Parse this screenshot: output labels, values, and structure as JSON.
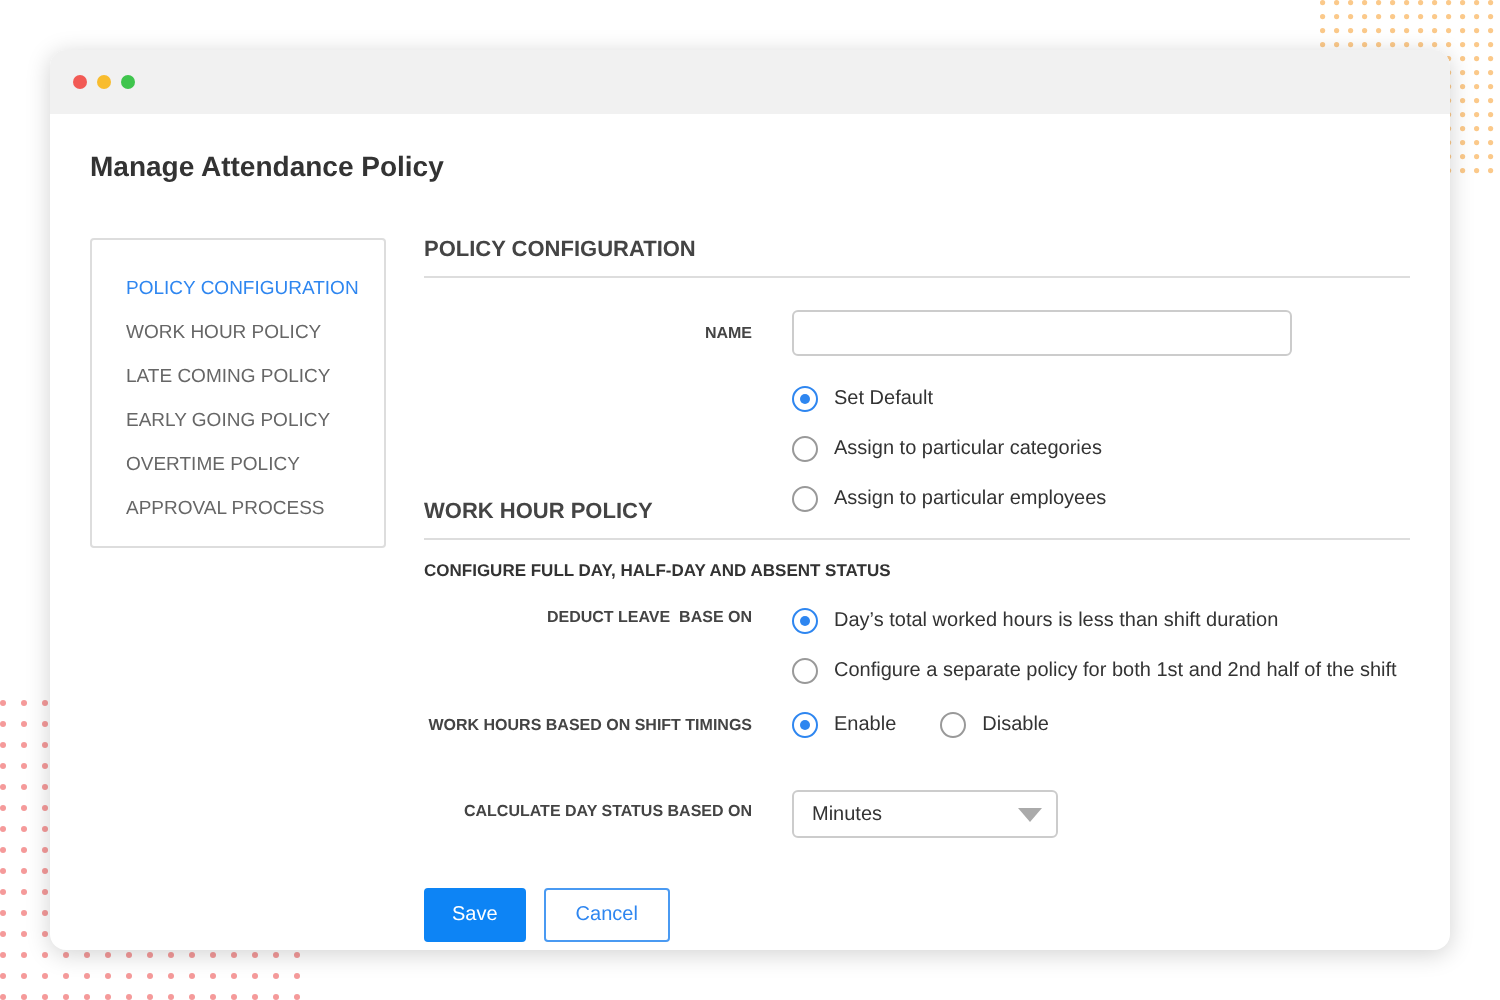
{
  "page_title": "Manage Attendance Policy",
  "sidebar": {
    "items": [
      {
        "label": "POLICY CONFIGURATION",
        "selected": true
      },
      {
        "label": "WORK HOUR POLICY",
        "selected": false
      },
      {
        "label": "LATE COMING POLICY",
        "selected": false
      },
      {
        "label": "EARLY GOING POLICY",
        "selected": false
      },
      {
        "label": "OVERTIME POLICY",
        "selected": false
      },
      {
        "label": "APPROVAL PROCESS",
        "selected": false
      }
    ]
  },
  "policy_configuration": {
    "heading": "POLICY CONFIGURATION",
    "name_label": "NAME",
    "assign_options": [
      {
        "label": "Set Default",
        "selected": true
      },
      {
        "label": "Assign to particular categories",
        "selected": false
      },
      {
        "label": "Assign to particular employees",
        "selected": false
      }
    ]
  },
  "work_hour_policy": {
    "heading": "WORK HOUR POLICY",
    "subheading": "CONFIGURE FULL DAY, HALF-DAY AND ABSENT STATUS",
    "deduct_leave": {
      "label": "DEDUCT LEAVE  BASE ON",
      "options": [
        {
          "label": "Day’s total worked hours is less than shift duration",
          "selected": true
        },
        {
          "label": "Configure a separate policy for both 1st and 2nd half of the shift",
          "selected": false
        }
      ]
    },
    "shift_timings": {
      "label": "WORK HOURS BASED ON SHIFT TIMINGS",
      "options": [
        {
          "label": "Enable",
          "selected": true
        },
        {
          "label": "Disable",
          "selected": false
        }
      ]
    },
    "day_status": {
      "label": "CALCULATE DAY STATUS BASED ON",
      "value": "Minutes"
    }
  },
  "buttons": [
    {
      "label": "Save",
      "kind": "primary"
    },
    {
      "label": "Cancel",
      "kind": "secondary"
    }
  ]
}
